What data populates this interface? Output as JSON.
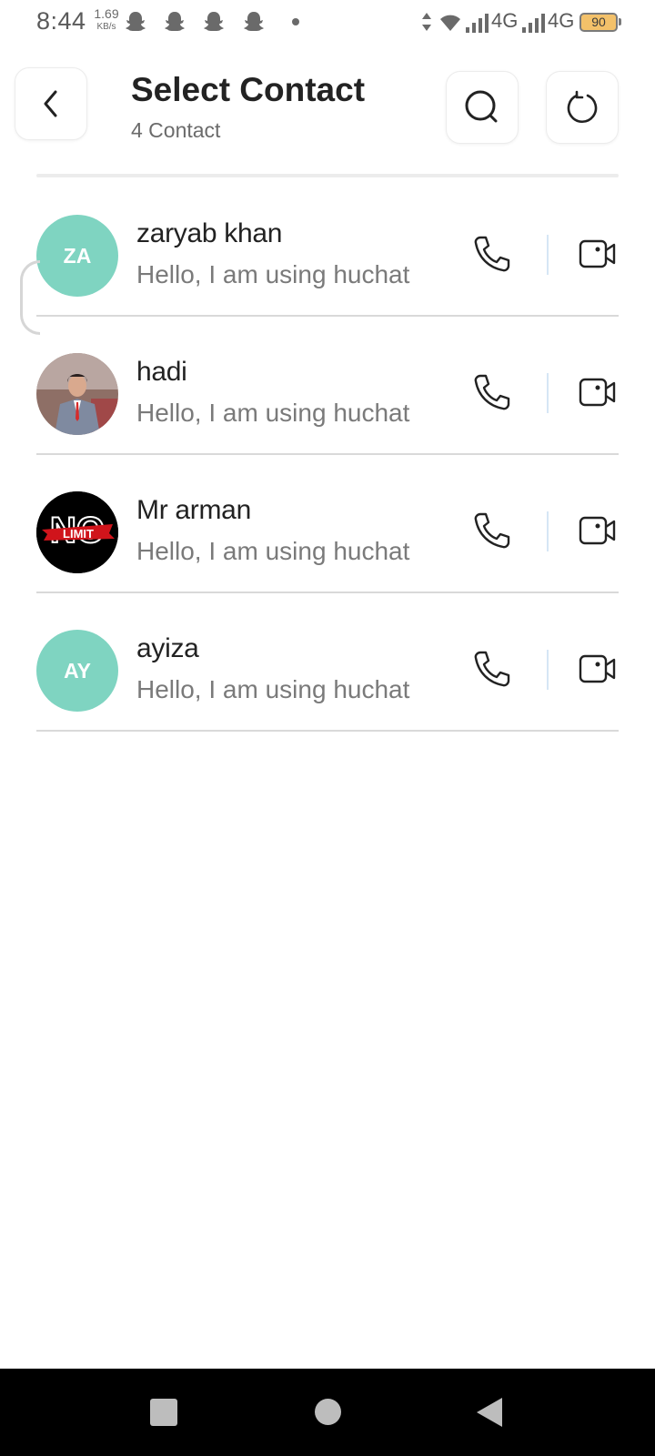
{
  "status_bar": {
    "time": "8:44",
    "net_speed": "1.69",
    "net_speed_unit": "KB/s",
    "network_1": "4G",
    "network_2": "4G",
    "battery": "90",
    "notification_icons": [
      "snapchat-icon",
      "snapchat-icon",
      "snapchat-icon",
      "snapchat-icon"
    ]
  },
  "header": {
    "title": "Select Contact",
    "subtitle": "4 Contact",
    "back_icon": "chevron-left-icon",
    "search_icon": "search-icon",
    "refresh_icon": "refresh-icon"
  },
  "contacts": [
    {
      "name": "zaryab khan",
      "status": "Hello, I am using huchat",
      "avatar_type": "initials",
      "initials": "ZA"
    },
    {
      "name": "hadi",
      "status": "Hello, I am using huchat",
      "avatar_type": "photo",
      "initials": ""
    },
    {
      "name": "Mr arman",
      "status": "Hello, I am using huchat",
      "avatar_type": "logo",
      "logo_text_1": "NO",
      "logo_text_2": "LIMIT"
    },
    {
      "name": "ayiza",
      "status": "Hello, I am using huchat",
      "avatar_type": "initials",
      "initials": "AY"
    }
  ],
  "colors": {
    "avatar_bg": "#7fd4c1",
    "text_primary": "#222222",
    "text_secondary": "#7a7a7a",
    "divider": "#d9d9d9",
    "nav_bar": "#000000"
  },
  "nav_bar": {
    "recents_icon": "square-icon",
    "home_icon": "circle-icon",
    "back_icon": "triangle-back-icon"
  }
}
